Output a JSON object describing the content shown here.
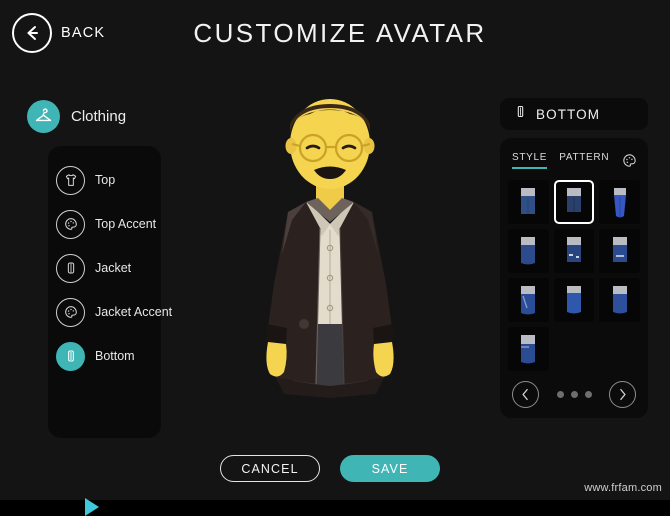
{
  "header": {
    "back_label": "BACK",
    "back_icon": "arrow-left-circle-icon",
    "title": "CUSTOMIZE AVATAR"
  },
  "sidebar": {
    "category": {
      "label": "Clothing",
      "icon": "clothes-hanger-icon"
    },
    "items": [
      {
        "label": "Top",
        "icon": "t-shirt-icon",
        "selected": false
      },
      {
        "label": "Top Accent",
        "icon": "palette-icon",
        "selected": false
      },
      {
        "label": "Jacket",
        "icon": "jacket-icon",
        "selected": false
      },
      {
        "label": "Jacket Accent",
        "icon": "palette-icon",
        "selected": false
      },
      {
        "label": "Bottom",
        "icon": "pants-icon",
        "selected": true
      }
    ],
    "expand_caret_icon": "caret-right-icon"
  },
  "avatar": {
    "skin_color": "#f5d44f",
    "hair_color": "#2e1f16",
    "glasses_color": "#c9a227",
    "mustache_color": "#1c1410",
    "shirt_color": "#e3dccd",
    "jacket_color": "#2b2220",
    "pants_color": "#3a3a3f"
  },
  "right_panel": {
    "header": {
      "label": "BOTTOM",
      "icon": "pants-icon"
    },
    "tabs": [
      {
        "label": "STYLE",
        "active": true
      },
      {
        "label": "PATTERN",
        "active": false
      }
    ],
    "tab_palette_icon": "palette-icon",
    "items": [
      {
        "index": 1,
        "selected": false,
        "waist": "#b9bcc2",
        "leg": "#2f4f86",
        "shape": "straight"
      },
      {
        "index": 2,
        "selected": true,
        "waist": "#b9bcc2",
        "leg": "#2a3f6b",
        "shape": "straight"
      },
      {
        "index": 3,
        "selected": false,
        "waist": "#b9bcc2",
        "leg": "#3557c4",
        "shape": "tapered"
      },
      {
        "index": 4,
        "selected": false,
        "waist": "#b9bcc2",
        "leg": "#2c4a8c",
        "shape": "straight"
      },
      {
        "index": 5,
        "selected": false,
        "waist": "#b9bcc2",
        "leg": "#29457f",
        "shape": "ripped"
      },
      {
        "index": 6,
        "selected": false,
        "waist": "#b9bcc2",
        "leg": "#2b4a90",
        "shape": "ripped"
      },
      {
        "index": 7,
        "selected": false,
        "waist": "#b9bcc2",
        "leg": "#2b4c96",
        "shape": "faded"
      },
      {
        "index": 8,
        "selected": false,
        "waist": "#b9bcc2",
        "leg": "#2f57ab",
        "shape": "straight"
      },
      {
        "index": 9,
        "selected": false,
        "waist": "#b9bcc2",
        "leg": "#2d4f9c",
        "shape": "straight"
      },
      {
        "index": 10,
        "selected": false,
        "waist": "#b9bcc2",
        "leg": "#2b4b93",
        "shape": "faded"
      }
    ],
    "pager": {
      "prev_icon": "chevron-left-icon",
      "next_icon": "chevron-right-icon",
      "page_count": 3,
      "current_page": 1
    }
  },
  "footer": {
    "cancel_label": "CANCEL",
    "save_label": "SAVE"
  },
  "watermark": "www.frfam.com",
  "colors": {
    "accent": "#3fb5b5",
    "caret": "#3ec8dc",
    "background": "#141414",
    "panel": "#0b0b0b"
  }
}
